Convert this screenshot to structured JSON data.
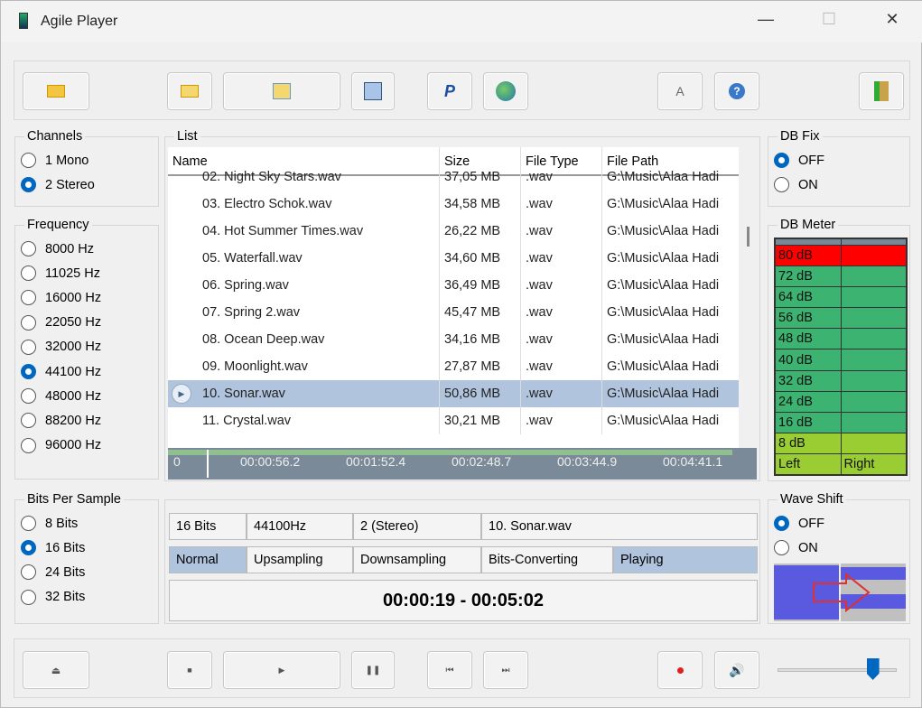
{
  "window": {
    "title": "Agile Player",
    "minimize": "—",
    "maximize": "☐",
    "close": "✕"
  },
  "toolbar": {
    "font_button": "A",
    "help_button": "?"
  },
  "channels": {
    "label": "Channels",
    "options": [
      "1 Mono",
      "2 Stereo"
    ],
    "selected": 1
  },
  "frequency": {
    "label": "Frequency",
    "options": [
      "8000 Hz",
      "11025 Hz",
      "16000 Hz",
      "22050 Hz",
      "32000 Hz",
      "44100 Hz",
      "48000 Hz",
      "88200 Hz",
      "96000 Hz"
    ],
    "selected": 5
  },
  "bits": {
    "label": "Bits Per Sample",
    "options": [
      "8 Bits",
      "16 Bits",
      "24 Bits",
      "32 Bits"
    ],
    "selected": 1
  },
  "list": {
    "label": "List",
    "columns": [
      "Name",
      "Size",
      "File Type",
      "File Path"
    ],
    "rows": [
      {
        "name": "02. Night Sky Stars.wav",
        "size": "37,05 MB",
        "type": ".wav",
        "path": "G:\\Music\\Alaa Hadi"
      },
      {
        "name": "03. Electro Schok.wav",
        "size": "34,58 MB",
        "type": ".wav",
        "path": "G:\\Music\\Alaa Hadi"
      },
      {
        "name": "04. Hot Summer Times.wav",
        "size": "26,22 MB",
        "type": ".wav",
        "path": "G:\\Music\\Alaa Hadi"
      },
      {
        "name": "05. Waterfall.wav",
        "size": "34,60 MB",
        "type": ".wav",
        "path": "G:\\Music\\Alaa Hadi"
      },
      {
        "name": "06. Spring.wav",
        "size": "36,49 MB",
        "type": ".wav",
        "path": "G:\\Music\\Alaa Hadi"
      },
      {
        "name": "07. Spring 2.wav",
        "size": "45,47 MB",
        "type": ".wav",
        "path": "G:\\Music\\Alaa Hadi"
      },
      {
        "name": "08. Ocean Deep.wav",
        "size": "34,16 MB",
        "type": ".wav",
        "path": "G:\\Music\\Alaa Hadi"
      },
      {
        "name": "09. Moonlight.wav",
        "size": "27,87 MB",
        "type": ".wav",
        "path": "G:\\Music\\Alaa Hadi"
      },
      {
        "name": "10. Sonar.wav",
        "size": "50,86 MB",
        "type": ".wav",
        "path": "G:\\Music\\Alaa Hadi"
      },
      {
        "name": "11. Crystal.wav",
        "size": "30,21 MB",
        "type": ".wav",
        "path": "G:\\Music\\Alaa Hadi"
      }
    ],
    "selected": 8
  },
  "timeline": {
    "ticks": [
      "0",
      "00:00:56.2",
      "00:01:52.4",
      "00:02:48.7",
      "00:03:44.9",
      "00:04:41.1"
    ],
    "position_fraction": 0.066
  },
  "dbfix": {
    "label": "DB Fix",
    "options": [
      "OFF",
      "ON"
    ],
    "selected": 0
  },
  "dbmeter": {
    "label": "DB Meter",
    "levels": [
      "80 dB",
      "72 dB",
      "64 dB",
      "56 dB",
      "48 dB",
      "40 dB",
      "32 dB",
      "24 dB",
      "16 dB",
      "8 dB"
    ],
    "left": "Left",
    "right": "Right",
    "colors": {
      "red": "#ff0000",
      "green": "#3cb371",
      "yellow": "#9acd32",
      "header": "#778899"
    }
  },
  "waveshift": {
    "label": "Wave Shift",
    "options": [
      "OFF",
      "ON"
    ],
    "selected": 0
  },
  "info": {
    "bits": "16 Bits",
    "freq": "44100Hz",
    "channels": "2 (Stereo)",
    "file": "10. Sonar.wav",
    "modes": [
      "Normal",
      "Upsampling",
      "Downsampling",
      "Bits-Converting",
      "Playing"
    ],
    "time": "00:00:19 - 00:05:02"
  },
  "volume": {
    "fraction": 0.8
  }
}
